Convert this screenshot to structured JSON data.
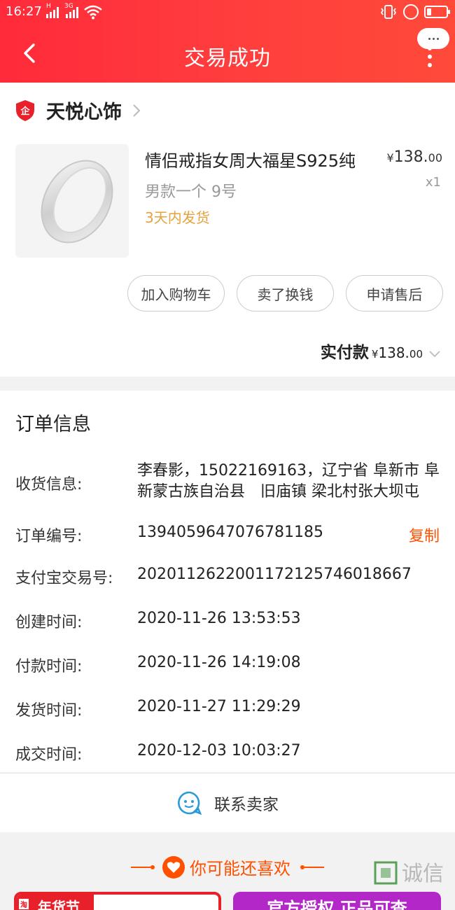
{
  "status_bar": {
    "time": "16:27",
    "signal1_label": "H",
    "signal2_label": "3G"
  },
  "header": {
    "title": "交易成功"
  },
  "store": {
    "name": "天悦心饰",
    "badge_text": "企"
  },
  "product": {
    "title": "情侣戒指女周大福星S925纯",
    "sku": "男款一个 9号",
    "shipping": "3天内发货",
    "price_currency": "¥",
    "price_main": "138.",
    "price_decimal": "00",
    "quantity": "x1"
  },
  "actions": {
    "add_cart": "加入购物车",
    "resell": "卖了换钱",
    "after_sale": "申请售后"
  },
  "payment": {
    "label": "实付款",
    "currency": "¥",
    "amount_main": "138.",
    "amount_decimal": "00"
  },
  "order_info": {
    "title": "订单信息",
    "rows": [
      {
        "label": "收货信息:",
        "value": "李春影，15022169163，辽宁省 阜新市 阜新蒙古族自治县　旧庙镇 梁北村张大坝屯"
      },
      {
        "label": "订单编号:",
        "value": "1394059647076781185",
        "action": "复制"
      },
      {
        "label": "支付宝交易号:",
        "value": "2020112622001172125746018667"
      },
      {
        "label": "创建时间:",
        "value": "2020-11-26 13:53:53"
      },
      {
        "label": "付款时间:",
        "value": "2020-11-26 14:19:08"
      },
      {
        "label": "发货时间:",
        "value": "2020-11-27 11:29:29"
      },
      {
        "label": "成交时间:",
        "value": "2020-12-03 10:03:27"
      }
    ]
  },
  "contact": {
    "label": "联系卖家"
  },
  "recommend": {
    "title": "你可能还喜欢",
    "card_left_banner": "年货节",
    "card_left_tag": "淘",
    "card_right_text": "官方授权 正品可查"
  },
  "watermark": {
    "text": "诚信"
  },
  "colors": {
    "header_red": "#ff2a3a",
    "accent_orange": "#ff5000",
    "ship_gold": "#e6a23c",
    "link_blue": "#2a9bd8"
  }
}
